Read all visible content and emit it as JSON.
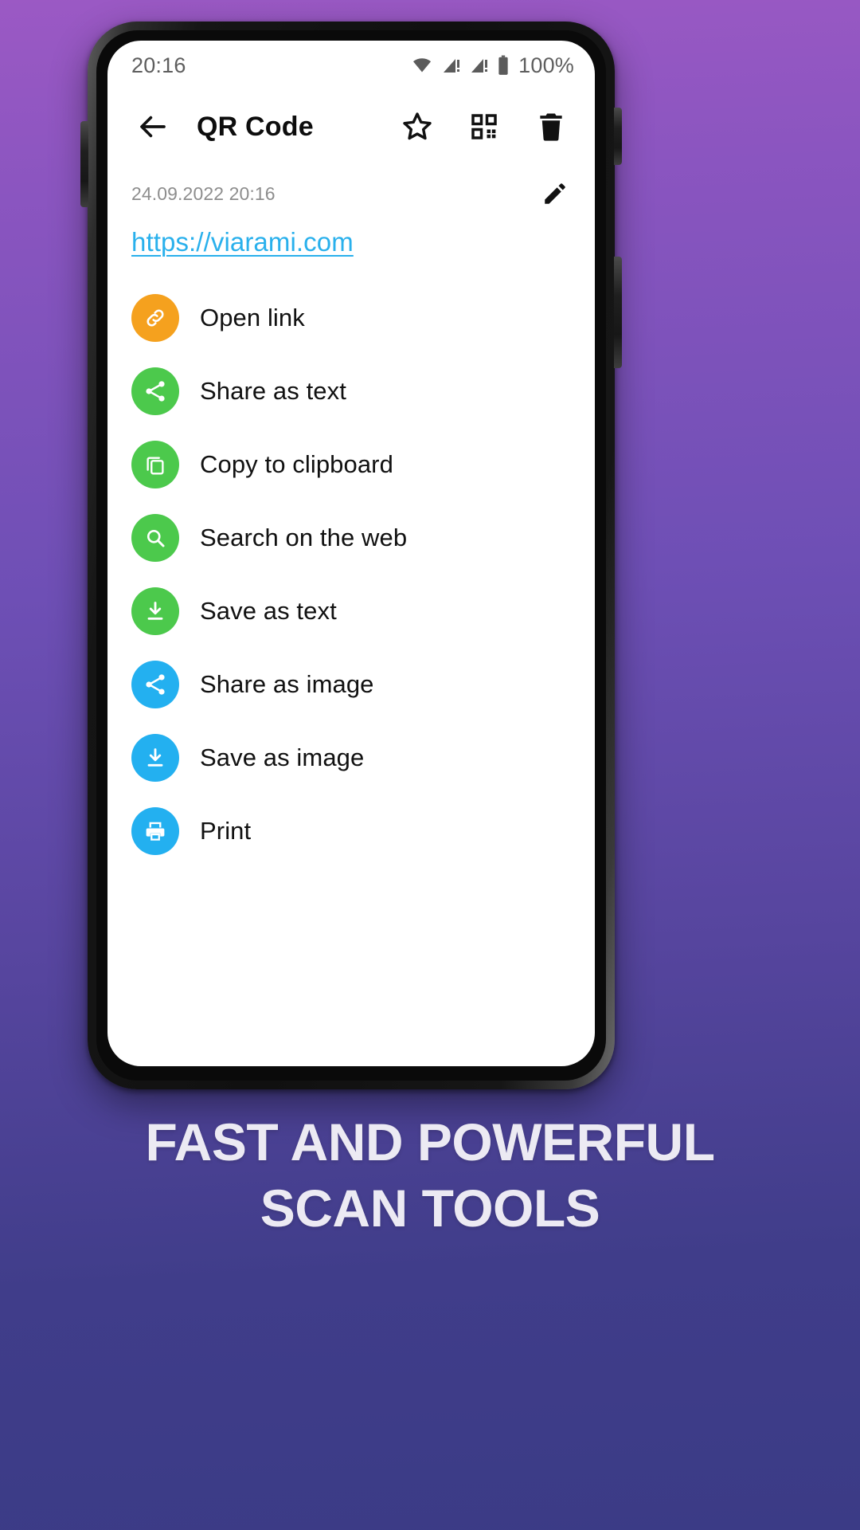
{
  "theme": {
    "background_gradient_top": "#9B59C4",
    "background_gradient_bottom": "#3B3B86",
    "accent_link": "#29B0EC",
    "orange": "#F5A11E",
    "green": "#4CC94C",
    "blue": "#23B0F0",
    "screen_background": "#FFFFFF"
  },
  "status_bar": {
    "time": "20:16",
    "battery_percent": "100%",
    "icons": [
      "wifi-icon",
      "signal-1-icon",
      "signal-2-icon",
      "battery-icon"
    ]
  },
  "toolbar": {
    "back_icon": "arrow-back-icon",
    "title": "QR Code",
    "actions": [
      {
        "icon": "star-outline-icon",
        "name": "favorite-button"
      },
      {
        "icon": "qr-code-icon",
        "name": "show-qr-button"
      },
      {
        "icon": "trash-icon",
        "name": "delete-button"
      }
    ]
  },
  "meta": {
    "scan_date": "24.09.2022 20:16",
    "edit_icon": "pencil-icon"
  },
  "content": {
    "url": "https://viarami.com"
  },
  "actions": [
    {
      "label": "Open link",
      "icon": "link-icon",
      "color": "#F5A11E"
    },
    {
      "label": "Share as text",
      "icon": "share-icon",
      "color": "#4CC94C"
    },
    {
      "label": "Copy to clipboard",
      "icon": "copy-icon",
      "color": "#4CC94C"
    },
    {
      "label": "Search on the web",
      "icon": "search-icon",
      "color": "#4CC94C"
    },
    {
      "label": "Save as text",
      "icon": "download-icon",
      "color": "#4CC94C"
    },
    {
      "label": "Share as image",
      "icon": "share-icon",
      "color": "#23B0F0"
    },
    {
      "label": "Save as image",
      "icon": "download-icon",
      "color": "#23B0F0"
    },
    {
      "label": "Print",
      "icon": "printer-icon",
      "color": "#23B0F0"
    }
  ],
  "caption": {
    "line1": "FAST AND POWERFUL",
    "line2": "SCAN TOOLS"
  }
}
